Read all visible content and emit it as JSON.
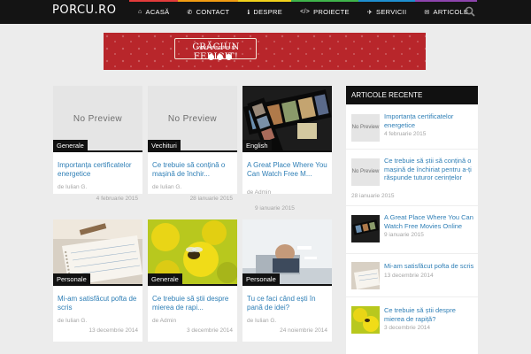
{
  "header": {
    "logo": "PORCU.RO",
    "nav": [
      {
        "label": "ACASĂ",
        "icon": "home-icon",
        "glyph": "⌂",
        "color": "#e33b3b"
      },
      {
        "label": "CONTACT",
        "icon": "phone-icon",
        "glyph": "✆",
        "color": "#f29c12"
      },
      {
        "label": "DESPRE",
        "icon": "info-icon",
        "glyph": "ℹ",
        "color": "#f2d21b"
      },
      {
        "label": "PROIECTE",
        "icon": "code-icon",
        "glyph": "</>",
        "color": "#3fb54b"
      },
      {
        "label": "SERVICII",
        "icon": "bullhorn-icon",
        "glyph": "✈",
        "color": "#1e8fd0"
      },
      {
        "label": "ARTICOLE",
        "icon": "comments-icon",
        "glyph": "✉",
        "color": "#8e44ad"
      }
    ]
  },
  "banner": {
    "title": "CRĂCIUN FERICIT!",
    "url": "www.treningstore.ro",
    "social_icons": [
      "facebook-icon",
      "twitter-icon",
      "instagram-icon"
    ]
  },
  "placeholder": "No Preview",
  "posts": [
    {
      "category": "Generale",
      "title": "Importanța certificatelor energetice",
      "author": "de Iulian G.",
      "date": "4 februarie 2015",
      "image": "none"
    },
    {
      "category": "Vechituri",
      "title": "Ce trebuie să conțină o mașină de închir...",
      "author": "de Iulian G.",
      "date": "28 ianuarie 2015",
      "image": "none"
    },
    {
      "category": "English",
      "title": "A Great Place Where You Can Watch Free M...",
      "author": "de Admin",
      "date": "9 ianuarie 2015",
      "image": "film"
    },
    {
      "category": "Personale",
      "title": "Mi-am satisfăcut pofta de scris",
      "author": "de Iulian G.",
      "date": "13 decembrie 2014",
      "image": "notebook"
    },
    {
      "category": "Generale",
      "title": "Ce trebuie să știi despre mierea de rapi...",
      "author": "de Admin",
      "date": "3 decembrie 2014",
      "image": "bee"
    },
    {
      "category": "Personale",
      "title": "Tu ce faci când ești în pană de idei?",
      "author": "de Iulian G.",
      "date": "24 noiembrie 2014",
      "image": "stress"
    }
  ],
  "sidebar": {
    "heading": "ARTICOLE RECENTE",
    "items": [
      {
        "title": "Importanța certificatelor energetice",
        "date": "4 februarie 2015",
        "thumb": "none"
      },
      {
        "title": "Ce trebuie să știi să conțină o mașină de închiriat pentru a-ți răspunde tuturor cerințelor",
        "date": "28 ianuarie 2015",
        "thumb": "none"
      },
      {
        "title": "A Great Place Where You Can Watch Free Movies Online",
        "date": "9 ianuarie 2015",
        "thumb": "film"
      },
      {
        "title": "Mi-am satisfăcut pofta de scris",
        "date": "13 decembrie 2014",
        "thumb": "notebook"
      },
      {
        "title": "Ce trebuie să știi despre mierea de rapiță?",
        "date": "3 decembrie 2014",
        "thumb": "bee"
      }
    ]
  }
}
